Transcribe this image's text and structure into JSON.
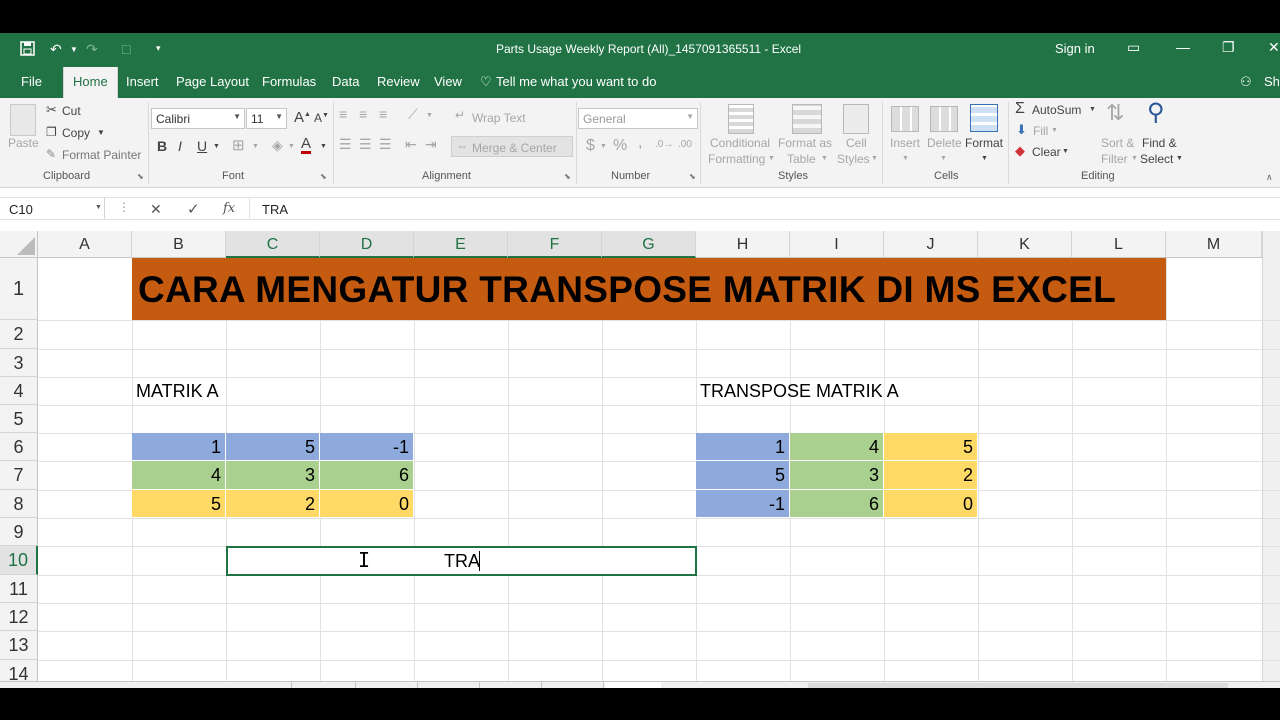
{
  "window": {
    "title": "Parts Usage Weekly Report (All)_1457091365511  -  Excel",
    "sign_in": "Sign in",
    "share": "Sh"
  },
  "ribbon_tabs": [
    "File",
    "Home",
    "Insert",
    "Page Layout",
    "Formulas",
    "Data",
    "Review",
    "View"
  ],
  "tell_me": "Tell me what you want to do",
  "clipboard": {
    "paste": "Paste",
    "cut": "Cut",
    "copy": "Copy",
    "format_painter": "Format Painter",
    "label": "Clipboard"
  },
  "font": {
    "name": "Calibri",
    "size": "11",
    "bold": "B",
    "italic": "I",
    "underline": "U",
    "label": "Font"
  },
  "alignment": {
    "wrap_text": "Wrap Text",
    "merge_center": "Merge & Center",
    "label": "Alignment"
  },
  "number": {
    "format": "General",
    "currency": "$",
    "percent": "%",
    "comma": ",",
    "label": "Number"
  },
  "styles": {
    "conditional_1": "Conditional",
    "conditional_2": "Formatting",
    "format_table_1": "Format as",
    "format_table_2": "Table",
    "cell_styles_1": "Cell",
    "cell_styles_2": "Styles",
    "label": "Styles"
  },
  "cells": {
    "insert": "Insert",
    "delete": "Delete",
    "format": "Format",
    "label": "Cells"
  },
  "editing": {
    "autosum": "AutoSum",
    "fill": "Fill",
    "clear": "Clear",
    "sort_1": "Sort &",
    "sort_2": "Filter",
    "find_1": "Find &",
    "find_2": "Select",
    "label": "Editing"
  },
  "formula_bar": {
    "name_box": "C10",
    "cancel": "✕",
    "enter": "✓",
    "fx": "fx",
    "content": "TRA"
  },
  "columns": [
    "A",
    "B",
    "C",
    "D",
    "E",
    "F",
    "G",
    "H",
    "I",
    "J",
    "K",
    "L",
    "M"
  ],
  "rows": [
    "1",
    "2",
    "3",
    "4",
    "5",
    "6",
    "7",
    "8",
    "9",
    "10",
    "11",
    "12",
    "13",
    "14"
  ],
  "sheet": {
    "title": "CARA MENGATUR TRANSPOSE MATRIK DI MS EXCEL",
    "label_a": "MATRIK A",
    "label_t": "TRANSPOSE MATRIK A",
    "matrix_a": [
      [
        "1",
        "5",
        "-1"
      ],
      [
        "4",
        "3",
        "6"
      ],
      [
        "5",
        "2",
        "0"
      ]
    ],
    "matrix_t": [
      [
        "1",
        "4",
        "5"
      ],
      [
        "5",
        "3",
        "2"
      ],
      [
        "-1",
        "6",
        "0"
      ]
    ],
    "editing_text": "TRA"
  },
  "colors": {
    "excel_green": "#217346",
    "title_fill": "#c55a11",
    "blue_fill": "#8ea9db",
    "green_fill": "#a9d08e",
    "yellow_fill": "#ffd966"
  }
}
